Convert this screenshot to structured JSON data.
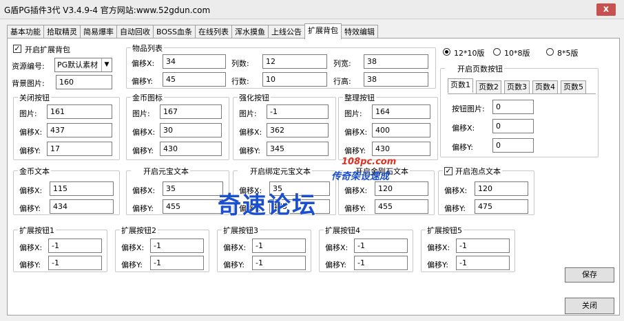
{
  "window": {
    "title": "G盾PG插件3代 V3.4.9-4   官方网站:www.52gdun.com",
    "close_glyph": "x"
  },
  "tabs": [
    "基本功能",
    "拾取精灵",
    "简易爆率",
    "自动回收",
    "BOSS血条",
    "在线列表",
    "浑水摸鱼",
    "上线公告",
    "扩展背包",
    "特效编辑"
  ],
  "active_tab_index": 8,
  "top_left": {
    "enable_label": "开启扩展背包",
    "enable_checked": true,
    "resource_label": "资源编号:",
    "resource_value": "PG默认素材",
    "bg_label": "背景图片:",
    "bg_value": "160"
  },
  "item_list": {
    "title": "物品列表",
    "offset_x_label": "偏移X:",
    "offset_x": "34",
    "cols_label": "列数:",
    "cols": "12",
    "col_width_label": "列宽:",
    "col_width": "38",
    "offset_y_label": "偏移Y:",
    "offset_y": "45",
    "rows_label": "行数:",
    "rows": "10",
    "row_height_label": "行高:",
    "row_height": "38"
  },
  "image_groups": [
    {
      "title": "关闭按钮",
      "image_label": "图片:",
      "image": "161",
      "x_label": "偏移X:",
      "x": "437",
      "y_label": "偏移Y:",
      "y": "17"
    },
    {
      "title": "金币图标",
      "image_label": "图片:",
      "image": "167",
      "x_label": "偏移X:",
      "x": "30",
      "y_label": "偏移Y:",
      "y": "430"
    },
    {
      "title": "强化按钮",
      "image_label": "图片:",
      "image": "-1",
      "x_label": "偏移X:",
      "x": "362",
      "y_label": "偏移Y:",
      "y": "345"
    },
    {
      "title": "整理按钮",
      "image_label": "图片:",
      "image": "164",
      "x_label": "偏移X:",
      "x": "400",
      "y_label": "偏移Y:",
      "y": "430"
    }
  ],
  "text_groups": [
    {
      "title": "金币文本",
      "x_label": "偏移X:",
      "x": "115",
      "y_label": "偏移Y:",
      "y": "434"
    },
    {
      "title": "开启元宝文本",
      "checkbox": true,
      "x_label": "偏移X:",
      "x": "35",
      "y_label": "偏移Y:",
      "y": "455"
    },
    {
      "title": "开启绑定元宝文本",
      "checkbox": true,
      "x_label": "偏移X:",
      "x": "35",
      "y_label": "偏移Y:",
      "y": "475"
    },
    {
      "title": "开启金刚石文本",
      "checkbox": true,
      "x_label": "偏移X:",
      "x": "120",
      "y_label": "偏移Y:",
      "y": "455"
    }
  ],
  "bubble_group": {
    "title": "开启泡点文本",
    "checkbox": true,
    "x_label": "偏移X:",
    "x": "120",
    "y_label": "偏移Y:",
    "y": "475"
  },
  "ext_buttons": [
    {
      "title": "扩展按钮1",
      "x_label": "偏移X:",
      "x": "-1",
      "y_label": "偏移Y:",
      "y": "-1"
    },
    {
      "title": "扩展按钮2",
      "x_label": "偏移X:",
      "x": "-1",
      "y_label": "偏移Y:",
      "y": "-1"
    },
    {
      "title": "扩展按钮3",
      "x_label": "偏移X:",
      "x": "-1",
      "y_label": "偏移Y:",
      "y": "-1"
    },
    {
      "title": "扩展按钮4",
      "x_label": "偏移X:",
      "x": "-1",
      "y_label": "偏移Y:",
      "y": "-1"
    },
    {
      "title": "扩展按钮5",
      "x_label": "偏移X:",
      "x": "-1",
      "y_label": "偏移Y:",
      "y": "-1"
    }
  ],
  "layout_options": {
    "selected_index": 0,
    "options": [
      "12*10版",
      "10*8版",
      "8*5版"
    ]
  },
  "page_buttons": {
    "enable_label": "开启页数按钮",
    "enable_checked": false,
    "tabs": [
      "页数1",
      "页数2",
      "页数3",
      "页数4",
      "页数5"
    ],
    "active_tab_index": 0,
    "image_label": "按钮图片:",
    "image": "0",
    "x_label": "偏移X:",
    "x": "0",
    "y_label": "偏移Y:",
    "y": "0"
  },
  "buttons": {
    "save": "保存",
    "close": "关闭"
  },
  "watermark": {
    "main": "奇速论坛",
    "url": "108pc.com",
    "sub": "传奇架设速成"
  }
}
